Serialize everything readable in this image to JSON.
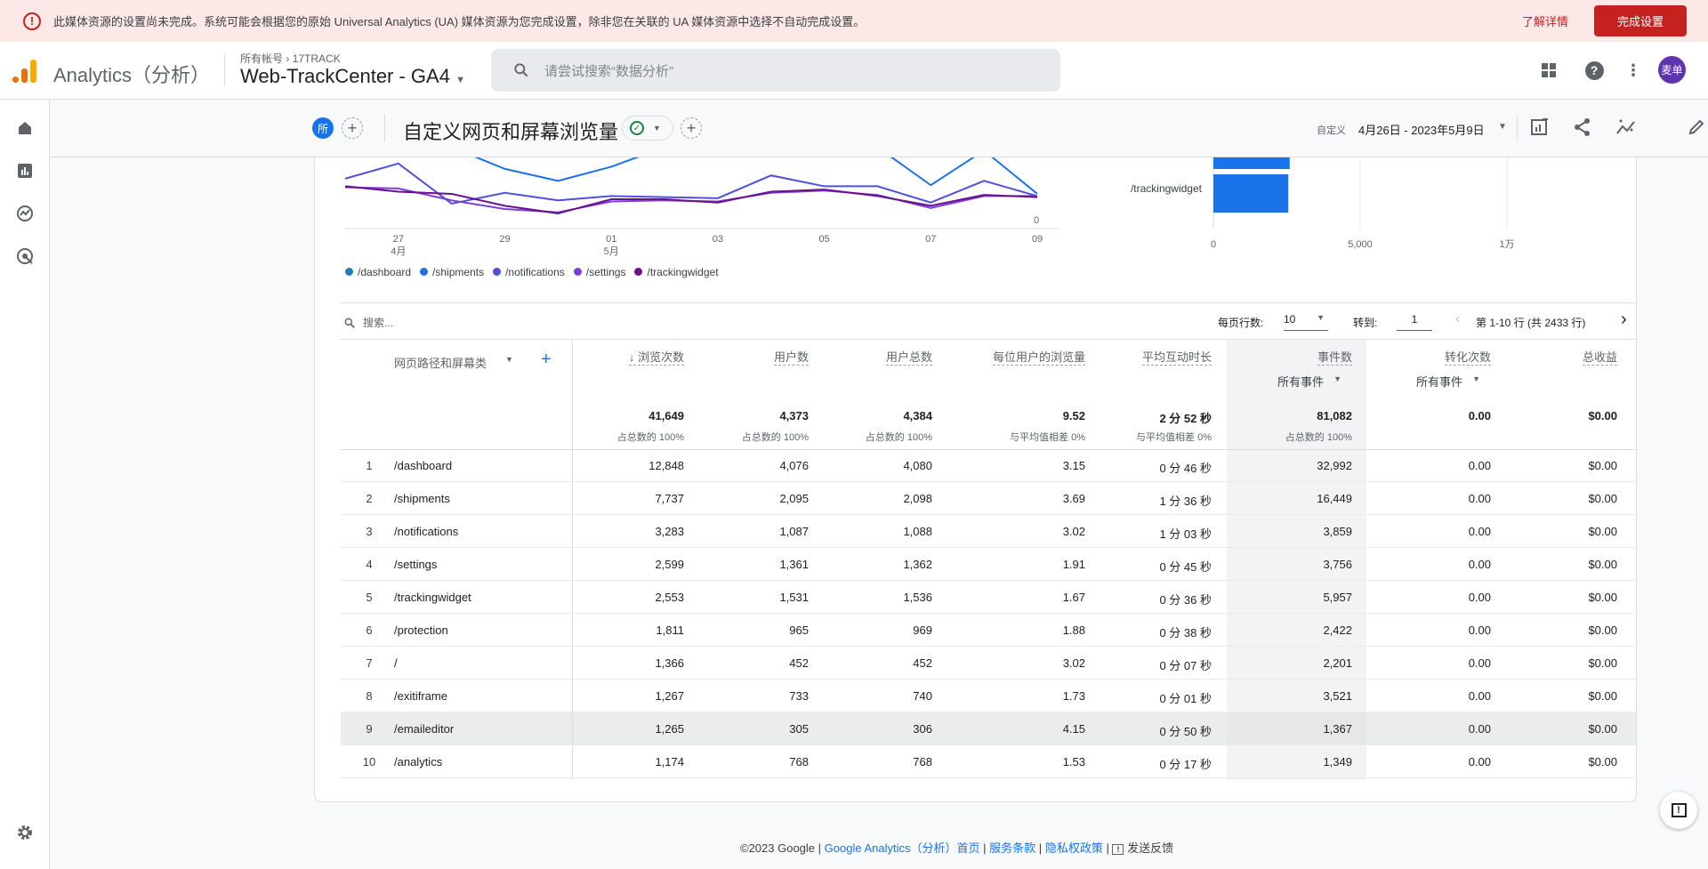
{
  "banner": {
    "message": "此媒体资源的设置尚未完成。系统可能会根据您的原始 Universal Analytics (UA) 媒体资源为您完成设置，除非您在关联的 UA 媒体资源中选择不自动完成设置。",
    "learn_more": "了解详情",
    "complete_setup": "完成设置"
  },
  "header": {
    "app_name": "Analytics（分析）",
    "breadcrumb_root": "所有帐号",
    "breadcrumb_account": "17TRACK",
    "property": "Web-TrackCenter - GA4",
    "search_placeholder": "请尝试搜索“数据分析”",
    "avatar": "麦单"
  },
  "subheader": {
    "comparison_chip": "所",
    "report_title": "自定义网页和屏幕浏览量",
    "date_label": "自定义",
    "date_range": "4月26日 - 2023年5月9日"
  },
  "chart_data": [
    {
      "type": "line",
      "title": "",
      "xlabel": "",
      "ylabel": "",
      "x": [
        "26",
        "27",
        "28",
        "29",
        "30",
        "01",
        "02",
        "03",
        "04",
        "05",
        "06",
        "07",
        "08",
        "09"
      ],
      "x_ticks": [
        {
          "label": "27",
          "sub": "4月",
          "index": 1
        },
        {
          "label": "29",
          "index": 3
        },
        {
          "label": "01",
          "sub": "5月",
          "index": 5
        },
        {
          "label": "03",
          "index": 7
        },
        {
          "label": "05",
          "index": 9
        },
        {
          "label": "07",
          "index": 11
        },
        {
          "label": "09",
          "index": 13
        }
      ],
      "y_ticks": [
        "0"
      ],
      "ylim": [
        0,
        1000
      ],
      "series": [
        {
          "name": "/dashboard",
          "color": "#1e7fb8",
          "values": [
            930,
            950,
            900,
            920,
            880,
            910,
            940,
            930,
            960,
            920,
            900,
            850,
            920,
            880
          ]
        },
        {
          "name": "/shipments",
          "color": "#1a73e8",
          "values": [
            800,
            900,
            750,
            550,
            440,
            570,
            750,
            850,
            800,
            780,
            750,
            400,
            720,
            320
          ]
        },
        {
          "name": "/notifications",
          "color": "#4f4fe0",
          "values": [
            460,
            600,
            230,
            330,
            260,
            300,
            290,
            280,
            490,
            390,
            390,
            240,
            440,
            300
          ]
        },
        {
          "name": "/settings",
          "color": "#7b3fd4",
          "values": [
            380,
            370,
            260,
            180,
            150,
            250,
            260,
            250,
            330,
            350,
            310,
            190,
            300,
            300
          ]
        },
        {
          "name": "/trackingwidget",
          "color": "#6a0f8e",
          "values": [
            390,
            340,
            320,
            210,
            140,
            270,
            270,
            240,
            340,
            360,
            300,
            210,
            310,
            290
          ]
        }
      ],
      "legend": "bottom-left"
    },
    {
      "type": "bar",
      "orientation": "horizontal",
      "categories": [
        "/settings",
        "/trackingwidget"
      ],
      "values": [
        2599,
        2553
      ],
      "x_ticks": [
        "0",
        "5,000",
        "1万"
      ],
      "xlim": [
        0,
        14000
      ],
      "color": "#1a73e8"
    }
  ],
  "table": {
    "search_placeholder": "搜索...",
    "rows_per_page_label": "每页行数:",
    "rows_per_page": "10",
    "goto_label": "转到:",
    "goto_value": "1",
    "range_text": "第 1-10 行 (共 2433 行)",
    "dimension_header": "网页路径和屏幕类",
    "columns": [
      {
        "label": "浏览次数",
        "total": "41,649",
        "sub": "占总数的 100%"
      },
      {
        "label": "用户数",
        "total": "4,373",
        "sub": "占总数的 100%"
      },
      {
        "label": "用户总数",
        "total": "4,384",
        "sub": "占总数的 100%"
      },
      {
        "label": "每位用户的浏览量",
        "total": "9.52",
        "sub": "与平均值相差 0%"
      },
      {
        "label": "平均互动时长",
        "total": "2 分 52 秒",
        "sub": "与平均值相差 0%"
      },
      {
        "label": "事件数",
        "filter": "所有事件",
        "total": "81,082",
        "sub": "占总数的 100%"
      },
      {
        "label": "转化次数",
        "filter": "所有事件",
        "total": "0.00",
        "sub": ""
      },
      {
        "label": "总收益",
        "total": "$0.00",
        "sub": ""
      }
    ],
    "rows": [
      [
        "1",
        "/dashboard",
        "12,848",
        "4,076",
        "4,080",
        "3.15",
        "0 分 46 秒",
        "32,992",
        "0.00",
        "$0.00"
      ],
      [
        "2",
        "/shipments",
        "7,737",
        "2,095",
        "2,098",
        "3.69",
        "1 分 36 秒",
        "16,449",
        "0.00",
        "$0.00"
      ],
      [
        "3",
        "/notifications",
        "3,283",
        "1,087",
        "1,088",
        "3.02",
        "1 分 03 秒",
        "3,859",
        "0.00",
        "$0.00"
      ],
      [
        "4",
        "/settings",
        "2,599",
        "1,361",
        "1,362",
        "1.91",
        "0 分 45 秒",
        "3,756",
        "0.00",
        "$0.00"
      ],
      [
        "5",
        "/trackingwidget",
        "2,553",
        "1,531",
        "1,536",
        "1.67",
        "0 分 36 秒",
        "5,957",
        "0.00",
        "$0.00"
      ],
      [
        "6",
        "/protection",
        "1,811",
        "965",
        "969",
        "1.88",
        "0 分 38 秒",
        "2,422",
        "0.00",
        "$0.00"
      ],
      [
        "7",
        "/",
        "1,366",
        "452",
        "452",
        "3.02",
        "0 分 07 秒",
        "2,201",
        "0.00",
        "$0.00"
      ],
      [
        "8",
        "/exitiframe",
        "1,267",
        "733",
        "740",
        "1.73",
        "0 分 01 秒",
        "3,521",
        "0.00",
        "$0.00"
      ],
      [
        "9",
        "/emaileditor",
        "1,265",
        "305",
        "306",
        "4.15",
        "0 分 50 秒",
        "1,367",
        "0.00",
        "$0.00"
      ],
      [
        "10",
        "/analytics",
        "1,174",
        "768",
        "768",
        "1.53",
        "0 分 17 秒",
        "1,349",
        "0.00",
        "$0.00"
      ]
    ]
  },
  "footer": {
    "copyright": "©2023 Google",
    "ga_home": "Google Analytics（分析）首页",
    "terms": "服务条款",
    "privacy": "隐私权政策",
    "feedback": "发送反馈",
    "sep": "|"
  }
}
